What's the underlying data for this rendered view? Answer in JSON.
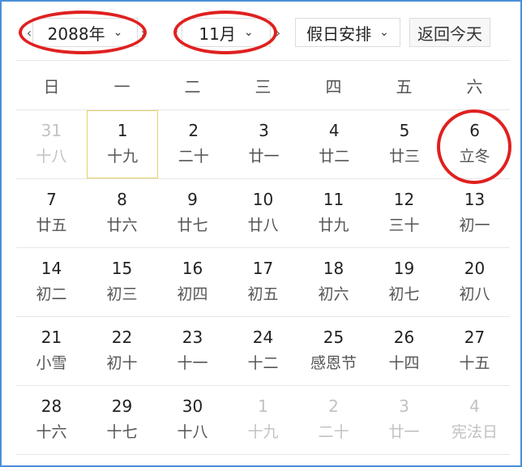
{
  "toolbar": {
    "year_label": "2088年",
    "month_label": "11月",
    "holiday_label": "假日安排",
    "today_label": "返回今天",
    "prev_arrow": "‹",
    "next_arrow": "›",
    "chevron": "⌄"
  },
  "weekdays": [
    "日",
    "一",
    "二",
    "三",
    "四",
    "五",
    "六"
  ],
  "weeks": [
    [
      {
        "day": "31",
        "lunar": "十八",
        "other": true
      },
      {
        "day": "1",
        "lunar": "十九",
        "today": true
      },
      {
        "day": "2",
        "lunar": "二十"
      },
      {
        "day": "3",
        "lunar": "廿一"
      },
      {
        "day": "4",
        "lunar": "廿二"
      },
      {
        "day": "5",
        "lunar": "廿三"
      },
      {
        "day": "6",
        "lunar": "立冬"
      }
    ],
    [
      {
        "day": "7",
        "lunar": "廿五"
      },
      {
        "day": "8",
        "lunar": "廿六"
      },
      {
        "day": "9",
        "lunar": "廿七"
      },
      {
        "day": "10",
        "lunar": "廿八"
      },
      {
        "day": "11",
        "lunar": "廿九"
      },
      {
        "day": "12",
        "lunar": "三十"
      },
      {
        "day": "13",
        "lunar": "初一"
      }
    ],
    [
      {
        "day": "14",
        "lunar": "初二"
      },
      {
        "day": "15",
        "lunar": "初三"
      },
      {
        "day": "16",
        "lunar": "初四"
      },
      {
        "day": "17",
        "lunar": "初五"
      },
      {
        "day": "18",
        "lunar": "初六"
      },
      {
        "day": "19",
        "lunar": "初七"
      },
      {
        "day": "20",
        "lunar": "初八"
      }
    ],
    [
      {
        "day": "21",
        "lunar": "小雪"
      },
      {
        "day": "22",
        "lunar": "初十"
      },
      {
        "day": "23",
        "lunar": "十一"
      },
      {
        "day": "24",
        "lunar": "十二"
      },
      {
        "day": "25",
        "lunar": "感恩节"
      },
      {
        "day": "26",
        "lunar": "十四"
      },
      {
        "day": "27",
        "lunar": "十五"
      }
    ],
    [
      {
        "day": "28",
        "lunar": "十六"
      },
      {
        "day": "29",
        "lunar": "十七"
      },
      {
        "day": "30",
        "lunar": "十八"
      },
      {
        "day": "1",
        "lunar": "十九",
        "other": true
      },
      {
        "day": "2",
        "lunar": "二十",
        "other": true
      },
      {
        "day": "3",
        "lunar": "廿一",
        "other": true
      },
      {
        "day": "4",
        "lunar": "宪法日",
        "other": true
      }
    ]
  ],
  "colors": {
    "frame_border": "#4a90d9",
    "annotation_ring": "#e02020",
    "today_border": "#e8cf6a",
    "other_month_text": "#c2c2c2"
  }
}
